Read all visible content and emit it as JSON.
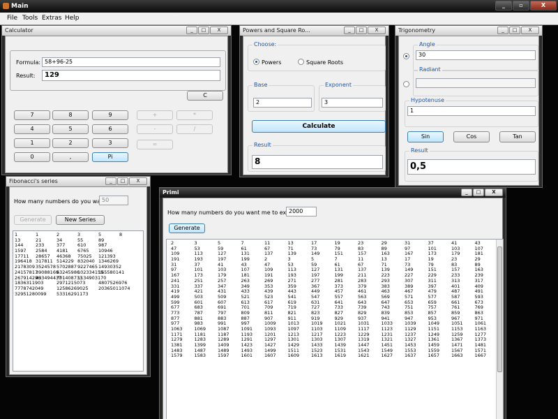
{
  "main": {
    "title": "Main",
    "controls": {
      "minimize": "_",
      "restore": "▫",
      "close": "X"
    },
    "menu": [
      "File",
      "Tools",
      "Extras",
      "Help"
    ]
  },
  "calculator": {
    "title": "Calculator",
    "formula_label": "Formula:",
    "formula_value": "58+96-25",
    "result_label": "Result:",
    "result_value": "129",
    "clear_label": "C",
    "digits": [
      "7",
      "8",
      "9",
      "4",
      "5",
      "6",
      "1",
      "2",
      "3",
      "0",
      ",",
      "Pi"
    ],
    "ops": [
      "+",
      "*",
      "-",
      "/",
      "="
    ]
  },
  "powers": {
    "title": "Powers and Square Ro...",
    "choose_label": "Choose:",
    "powers_label": "Powers",
    "roots_label": "Square Roots",
    "base_label": "Base",
    "base_value": "2",
    "exponent_label": "Exponent",
    "exponent_value": "3",
    "calculate_label": "Calculate",
    "result_label": "Result",
    "result_value": "8"
  },
  "trig": {
    "title": "Trigonometry",
    "angle_label": "Angle",
    "angle_value": "30",
    "radiant_label": "Radiant",
    "radiant_value": "",
    "hypotenuse_label": "Hypotenuse",
    "hypotenuse_value": "1",
    "sin_label": "Sin",
    "cos_label": "Cos",
    "tan_label": "Tan",
    "result_label": "Result",
    "result_value": "0,5"
  },
  "fibonacci": {
    "title": "Fibonacci's series",
    "question": "How many numbers do you want?",
    "count_value": "50",
    "generate_label": "Generate",
    "new_series_label": "New Series",
    "rows": [
      [
        "1",
        "1",
        "2",
        "3",
        "5",
        "8"
      ],
      [
        "13",
        "21",
        "34",
        "55",
        "89"
      ],
      [
        "144",
        "233",
        "377",
        "610",
        "987"
      ],
      [
        "1597",
        "2584",
        "4181",
        "6765",
        "10946"
      ],
      [
        "17711",
        "28657",
        "46368",
        "75025",
        "121393"
      ],
      [
        "196418",
        "317811",
        "514229",
        "832040",
        "1346269"
      ],
      [
        "2178309",
        "3524578",
        "5702887",
        "9227465",
        "14930352"
      ],
      [
        "24157817",
        "39088169",
        "63245986",
        "102334155",
        "165580141"
      ],
      [
        "267914296",
        "433494437",
        "701408733",
        "1134903170"
      ],
      [
        "1836311903",
        "",
        "2971215073",
        "",
        "4807526976"
      ],
      [
        "7778742049",
        "",
        "12586269025",
        "",
        "20365011074"
      ],
      [
        "32951280099",
        "",
        "53316291173"
      ]
    ]
  },
  "primi": {
    "title": "Primi",
    "question": "How many numbers do you want me to examine?",
    "count_value": "2000",
    "generate_label": "Generate",
    "rows": [
      [
        "2",
        "3",
        "5",
        "7",
        "11",
        "13",
        "17",
        "19",
        "23",
        "29",
        "31",
        "37",
        "41",
        "43"
      ],
      [
        "47",
        "53",
        "59",
        "61",
        "67",
        "71",
        "73",
        "79",
        "83",
        "89",
        "97",
        "101",
        "103",
        "107"
      ],
      [
        "109",
        "113",
        "127",
        "131",
        "137",
        "139",
        "149",
        "151",
        "157",
        "163",
        "167",
        "173",
        "179",
        "181"
      ],
      [
        "191",
        "193",
        "197",
        "199",
        "2",
        "3",
        "5",
        "7",
        "11",
        "13",
        "17",
        "19",
        "23",
        "29"
      ],
      [
        "31",
        "37",
        "41",
        "43",
        "47",
        "53",
        "59",
        "61",
        "67",
        "71",
        "73",
        "79",
        "83",
        "89"
      ],
      [
        "97",
        "101",
        "103",
        "107",
        "109",
        "113",
        "127",
        "131",
        "137",
        "139",
        "149",
        "151",
        "157",
        "163"
      ],
      [
        "167",
        "173",
        "179",
        "181",
        "191",
        "193",
        "197",
        "199",
        "211",
        "223",
        "227",
        "229",
        "233",
        "239"
      ],
      [
        "241",
        "251",
        "257",
        "263",
        "269",
        "271",
        "277",
        "281",
        "283",
        "293",
        "307",
        "311",
        "313",
        "317"
      ],
      [
        "331",
        "337",
        "347",
        "349",
        "353",
        "359",
        "367",
        "373",
        "379",
        "383",
        "389",
        "397",
        "401",
        "409"
      ],
      [
        "419",
        "421",
        "431",
        "433",
        "439",
        "443",
        "449",
        "457",
        "461",
        "463",
        "467",
        "479",
        "487",
        "491"
      ],
      [
        "499",
        "503",
        "509",
        "521",
        "523",
        "541",
        "547",
        "557",
        "563",
        "569",
        "571",
        "577",
        "587",
        "593"
      ],
      [
        "599",
        "601",
        "607",
        "613",
        "617",
        "619",
        "631",
        "641",
        "643",
        "647",
        "653",
        "659",
        "661",
        "673"
      ],
      [
        "677",
        "683",
        "691",
        "701",
        "709",
        "719",
        "727",
        "733",
        "739",
        "743",
        "751",
        "757",
        "761",
        "769"
      ],
      [
        "773",
        "787",
        "797",
        "809",
        "811",
        "821",
        "823",
        "827",
        "829",
        "839",
        "853",
        "857",
        "859",
        "863"
      ],
      [
        "877",
        "881",
        "883",
        "887",
        "907",
        "911",
        "919",
        "929",
        "937",
        "941",
        "947",
        "953",
        "967",
        "971"
      ],
      [
        "977",
        "983",
        "991",
        "997",
        "1009",
        "1013",
        "1019",
        "1021",
        "1031",
        "1033",
        "1039",
        "1049",
        "1051",
        "1061"
      ],
      [
        "1063",
        "1069",
        "1087",
        "1091",
        "1093",
        "1097",
        "1103",
        "1109",
        "1117",
        "1123",
        "1129",
        "1151",
        "1153",
        "1163"
      ],
      [
        "1171",
        "1181",
        "1187",
        "1193",
        "1201",
        "1213",
        "1217",
        "1223",
        "1229",
        "1231",
        "1237",
        "1249",
        "1259",
        "1277"
      ],
      [
        "1279",
        "1283",
        "1289",
        "1291",
        "1297",
        "1301",
        "1303",
        "1307",
        "1319",
        "1321",
        "1327",
        "1361",
        "1367",
        "1373"
      ],
      [
        "1381",
        "1399",
        "1409",
        "1423",
        "1427",
        "1429",
        "1433",
        "1439",
        "1447",
        "1451",
        "1453",
        "1459",
        "1471",
        "1481"
      ],
      [
        "1483",
        "1487",
        "1489",
        "1493",
        "1499",
        "1511",
        "1523",
        "1531",
        "1543",
        "1549",
        "1553",
        "1559",
        "1567",
        "1571"
      ],
      [
        "1579",
        "1583",
        "1597",
        "1601",
        "1607",
        "1609",
        "1613",
        "1619",
        "1621",
        "1627",
        "1637",
        "1657",
        "1663",
        "1667"
      ]
    ]
  }
}
